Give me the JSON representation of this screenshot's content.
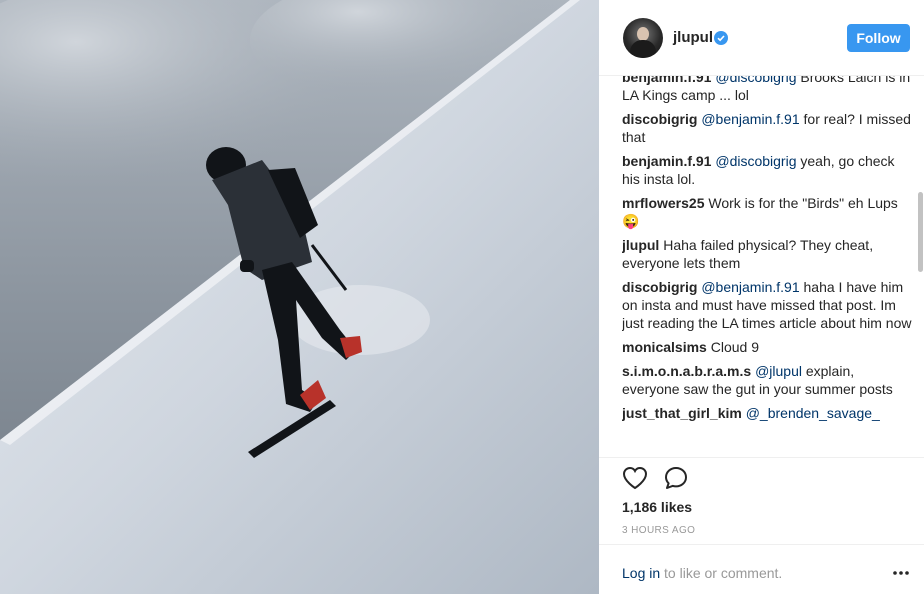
{
  "post": {
    "username": "jlupul",
    "follow_label": "Follow",
    "likes": "1,186 likes",
    "timestamp": "3 HOURS AGO",
    "login_link": "Log in",
    "login_suffix": " to like or comment."
  },
  "comments": [
    {
      "user": "benjamin.f.91",
      "mention": "@discobigrig",
      "text": " Brooks Laich is in LA Kings camp ... lol"
    },
    {
      "user": "discobigrig",
      "mention": "@benjamin.f.91",
      "text": " for real? I missed that"
    },
    {
      "user": "benjamin.f.91",
      "mention": "@discobigrig",
      "text": " yeah, go check his insta lol."
    },
    {
      "user": "mrflowers25",
      "mention": "",
      "text": "Work is for the \"Birds\" eh Lups 😜"
    },
    {
      "user": "jlupul",
      "mention": "",
      "text": "Haha failed physical? They cheat, everyone lets them"
    },
    {
      "user": "discobigrig",
      "mention": "@benjamin.f.91",
      "text": " haha I have him on insta and must have missed that post. Im just reading the LA times article about him now"
    },
    {
      "user": "monicalsims",
      "mention": "",
      "text": "Cloud 9"
    },
    {
      "user": "s.i.m.o.n.a.b.r.a.m.s",
      "mention": "@jlupul",
      "text": " explain, everyone saw the gut in your summer posts"
    },
    {
      "user": "just_that_girl_kim",
      "mention": "@_brenden_savage_",
      "text": ""
    }
  ],
  "icons": {
    "verified": "verified-badge-icon",
    "heart": "heart-icon",
    "comment": "comment-bubble-icon",
    "more": "more-options-icon"
  },
  "colors": {
    "follow_button": "#3897f0",
    "link": "#003569",
    "muted": "#999999"
  }
}
